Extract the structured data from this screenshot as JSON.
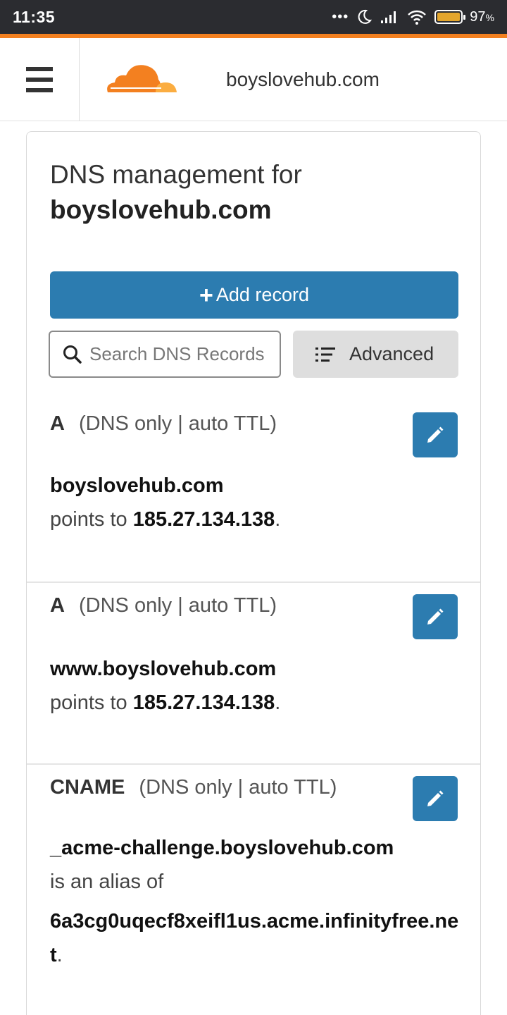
{
  "status_bar": {
    "time": "11:35",
    "dots": "•••",
    "battery_pct": "97",
    "battery_unit": "%"
  },
  "header": {
    "domain": "boyslovehub.com"
  },
  "colors": {
    "brand_orange": "#f38020",
    "primary_blue": "#2c7cb0"
  },
  "page": {
    "title_prefix": "DNS management for",
    "title_domain": "boyslovehub.com"
  },
  "toolbar": {
    "add_plus": "+",
    "add_label": "Add record",
    "search_placeholder": "Search DNS Records",
    "advanced_label": "Advanced"
  },
  "records": [
    {
      "type": "A",
      "meta": "(DNS only | auto TTL)",
      "name": "boyslovehub.com",
      "relation": "points to",
      "target": "185.27.134.138",
      "end": "."
    },
    {
      "type": "A",
      "meta": "(DNS only | auto TTL)",
      "name": "www.boyslovehub.com",
      "relation": "points to",
      "target": "185.27.134.138",
      "end": "."
    },
    {
      "type": "CNAME",
      "meta": "(DNS only | auto TTL)",
      "name": "_acme-challenge.boyslovehub.com",
      "relation": "is an alias of",
      "target": "6a3cg0uqecf8xeifl1us.acme.infinityfree.net",
      "end": "."
    }
  ]
}
